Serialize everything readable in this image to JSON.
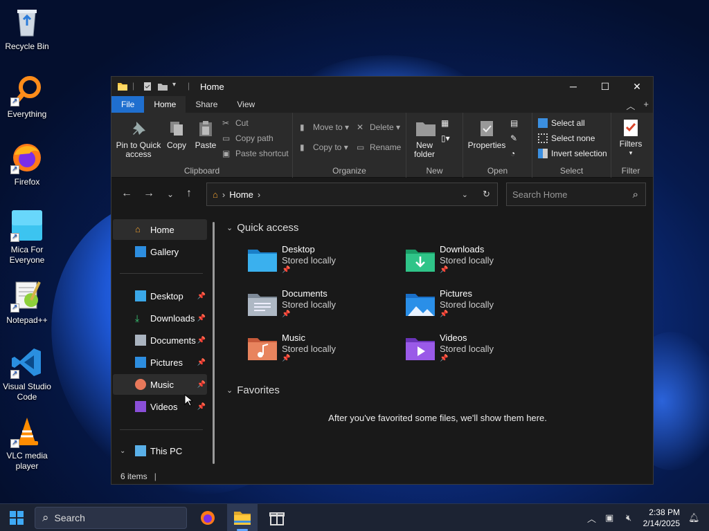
{
  "desktop": {
    "icons": [
      {
        "label": "Recycle Bin"
      },
      {
        "label": "Everything"
      },
      {
        "label": "Firefox"
      },
      {
        "label": "Mica For Everyone"
      },
      {
        "label": "Notepad++"
      },
      {
        "label": "Visual Studio Code"
      },
      {
        "label": "VLC media player"
      }
    ]
  },
  "window": {
    "title": "Home",
    "tabs": [
      {
        "label": "File"
      },
      {
        "label": "Home"
      },
      {
        "label": "Share"
      },
      {
        "label": "View"
      }
    ],
    "ribbon": {
      "clipboard": {
        "label": "Clipboard",
        "pin": "Pin to Quick access",
        "copy": "Copy",
        "paste": "Paste",
        "cut": "Cut",
        "copy_path": "Copy path",
        "paste_shortcut": "Paste shortcut"
      },
      "organize": {
        "label": "Organize",
        "move_to": "Move to",
        "copy_to": "Copy to",
        "delete": "Delete",
        "rename": "Rename"
      },
      "new": {
        "label": "New",
        "new_folder": "New folder"
      },
      "open": {
        "label": "Open",
        "properties": "Properties"
      },
      "select": {
        "label": "Select",
        "select_all": "Select all",
        "select_none": "Select none",
        "invert": "Invert selection"
      },
      "filter": {
        "label": "Filter",
        "filters": "Filters"
      }
    },
    "address": {
      "path": "Home",
      "search_placeholder": "Search Home"
    },
    "sidebar": {
      "items": [
        {
          "label": "Home"
        },
        {
          "label": "Gallery"
        },
        {
          "label": "Desktop"
        },
        {
          "label": "Downloads"
        },
        {
          "label": "Documents"
        },
        {
          "label": "Pictures"
        },
        {
          "label": "Music"
        },
        {
          "label": "Videos"
        },
        {
          "label": "This PC"
        }
      ]
    },
    "content": {
      "quick_access_title": "Quick access",
      "tiles": [
        {
          "name": "Desktop",
          "sub": "Stored locally"
        },
        {
          "name": "Downloads",
          "sub": "Stored locally"
        },
        {
          "name": "Documents",
          "sub": "Stored locally"
        },
        {
          "name": "Pictures",
          "sub": "Stored locally"
        },
        {
          "name": "Music",
          "sub": "Stored locally"
        },
        {
          "name": "Videos",
          "sub": "Stored locally"
        }
      ],
      "favorites_title": "Favorites",
      "favorites_empty": "After you've favorited some files, we'll show them here."
    },
    "status": {
      "items": "6 items"
    }
  },
  "taskbar": {
    "search_label": "Search",
    "time": "2:38 PM",
    "date": "2/14/2025"
  }
}
